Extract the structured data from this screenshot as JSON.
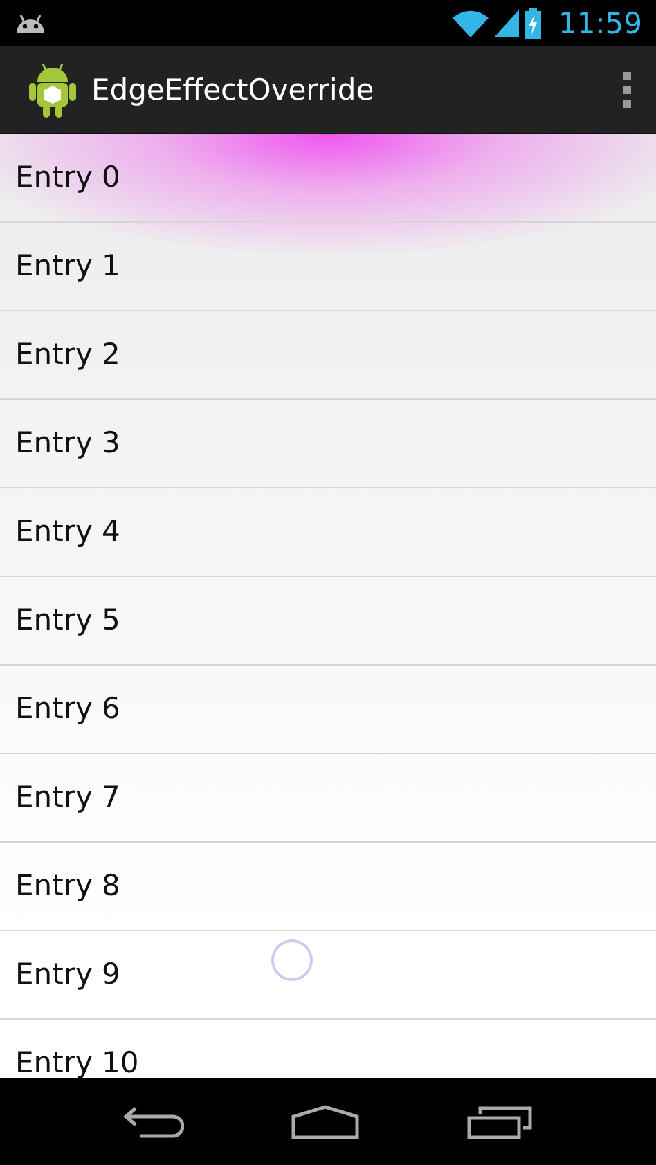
{
  "status_bar": {
    "time": "11:59"
  },
  "action_bar": {
    "title": "EdgeEffectOverride"
  },
  "list": {
    "items": [
      {
        "label": "Entry 0"
      },
      {
        "label": "Entry 1"
      },
      {
        "label": "Entry 2"
      },
      {
        "label": "Entry 3"
      },
      {
        "label": "Entry 4"
      },
      {
        "label": "Entry 5"
      },
      {
        "label": "Entry 6"
      },
      {
        "label": "Entry 7"
      },
      {
        "label": "Entry 8"
      },
      {
        "label": "Entry 9"
      },
      {
        "label": "Entry 10"
      }
    ]
  }
}
